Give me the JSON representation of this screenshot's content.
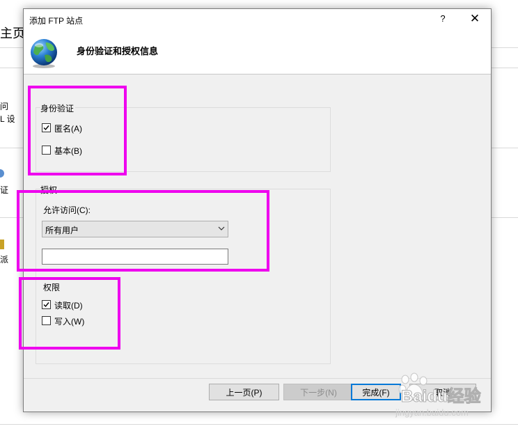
{
  "background": {
    "title": "主页",
    "items": [
      "问",
      "L 设",
      "证",
      "派"
    ]
  },
  "dialog": {
    "title": "添加 FTP 站点",
    "help_label": "?",
    "close_label": "✕",
    "header": "身份验证和授权信息",
    "auth_group": {
      "label": "身份验证",
      "anonymous": {
        "label": "匿名(A)",
        "checked": true
      },
      "basic": {
        "label": "基本(B)",
        "checked": false
      }
    },
    "authz_group": {
      "label": "授权",
      "allow_access_label": "允许访问(C):",
      "allow_access_value": "所有用户",
      "user_input_value": ""
    },
    "perm_group": {
      "label": "权限",
      "read": {
        "label": "读取(D)",
        "checked": true
      },
      "write": {
        "label": "写入(W)",
        "checked": false
      }
    },
    "buttons": {
      "previous": "上一页(P)",
      "next": "下一步(N)",
      "finish": "完成(F)",
      "cancel": "取消"
    }
  },
  "watermark": {
    "brand": "Baidu经验",
    "url": "jingyan.baidu.com"
  },
  "colors": {
    "highlight": "#ee00ee",
    "accent": "#0078d7"
  }
}
